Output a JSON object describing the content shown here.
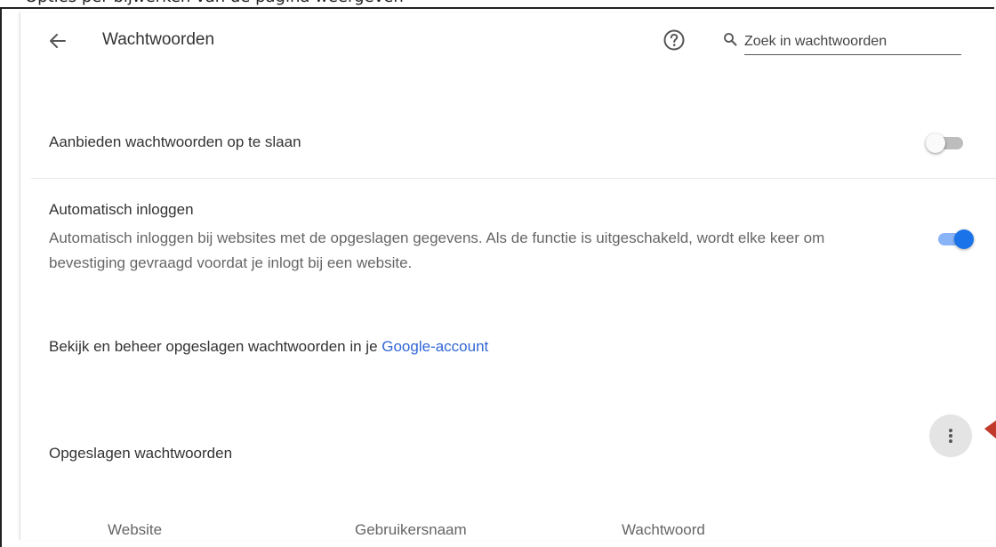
{
  "caption": "Opties per bijwerken van de pagina weergeven",
  "header": {
    "back_icon": "arrow-left-icon",
    "title": "Wachtwoorden",
    "help_icon": "help-circle-icon",
    "search_icon": "search-icon",
    "search_placeholder": "Zoek in wachtwoorden",
    "search_value": ""
  },
  "settings": {
    "offer_save": {
      "label": "Aanbieden wachtwoorden op te slaan",
      "enabled": false
    },
    "auto_signin": {
      "title": "Automatisch inloggen",
      "description": "Automatisch inloggen bij websites met de opgeslagen gegevens. Als de functie is uitgeschakeld, wordt elke keer om bevestiging gevraagd voordat je inlogt bij een website.",
      "enabled": true
    },
    "manage": {
      "text": "Bekijk en beheer opgeslagen wachtwoorden in je ",
      "link": "Google-account"
    }
  },
  "saved_passwords": {
    "title": "Opgeslagen wachtwoorden",
    "more_icon": "more-vert-icon",
    "columns": [
      "Website",
      "Gebruikersnaam",
      "Wachtwoord"
    ]
  },
  "colors": {
    "accent": "#1a73e8",
    "link": "#3367d6",
    "annotation_arrow": "#c0392b"
  }
}
